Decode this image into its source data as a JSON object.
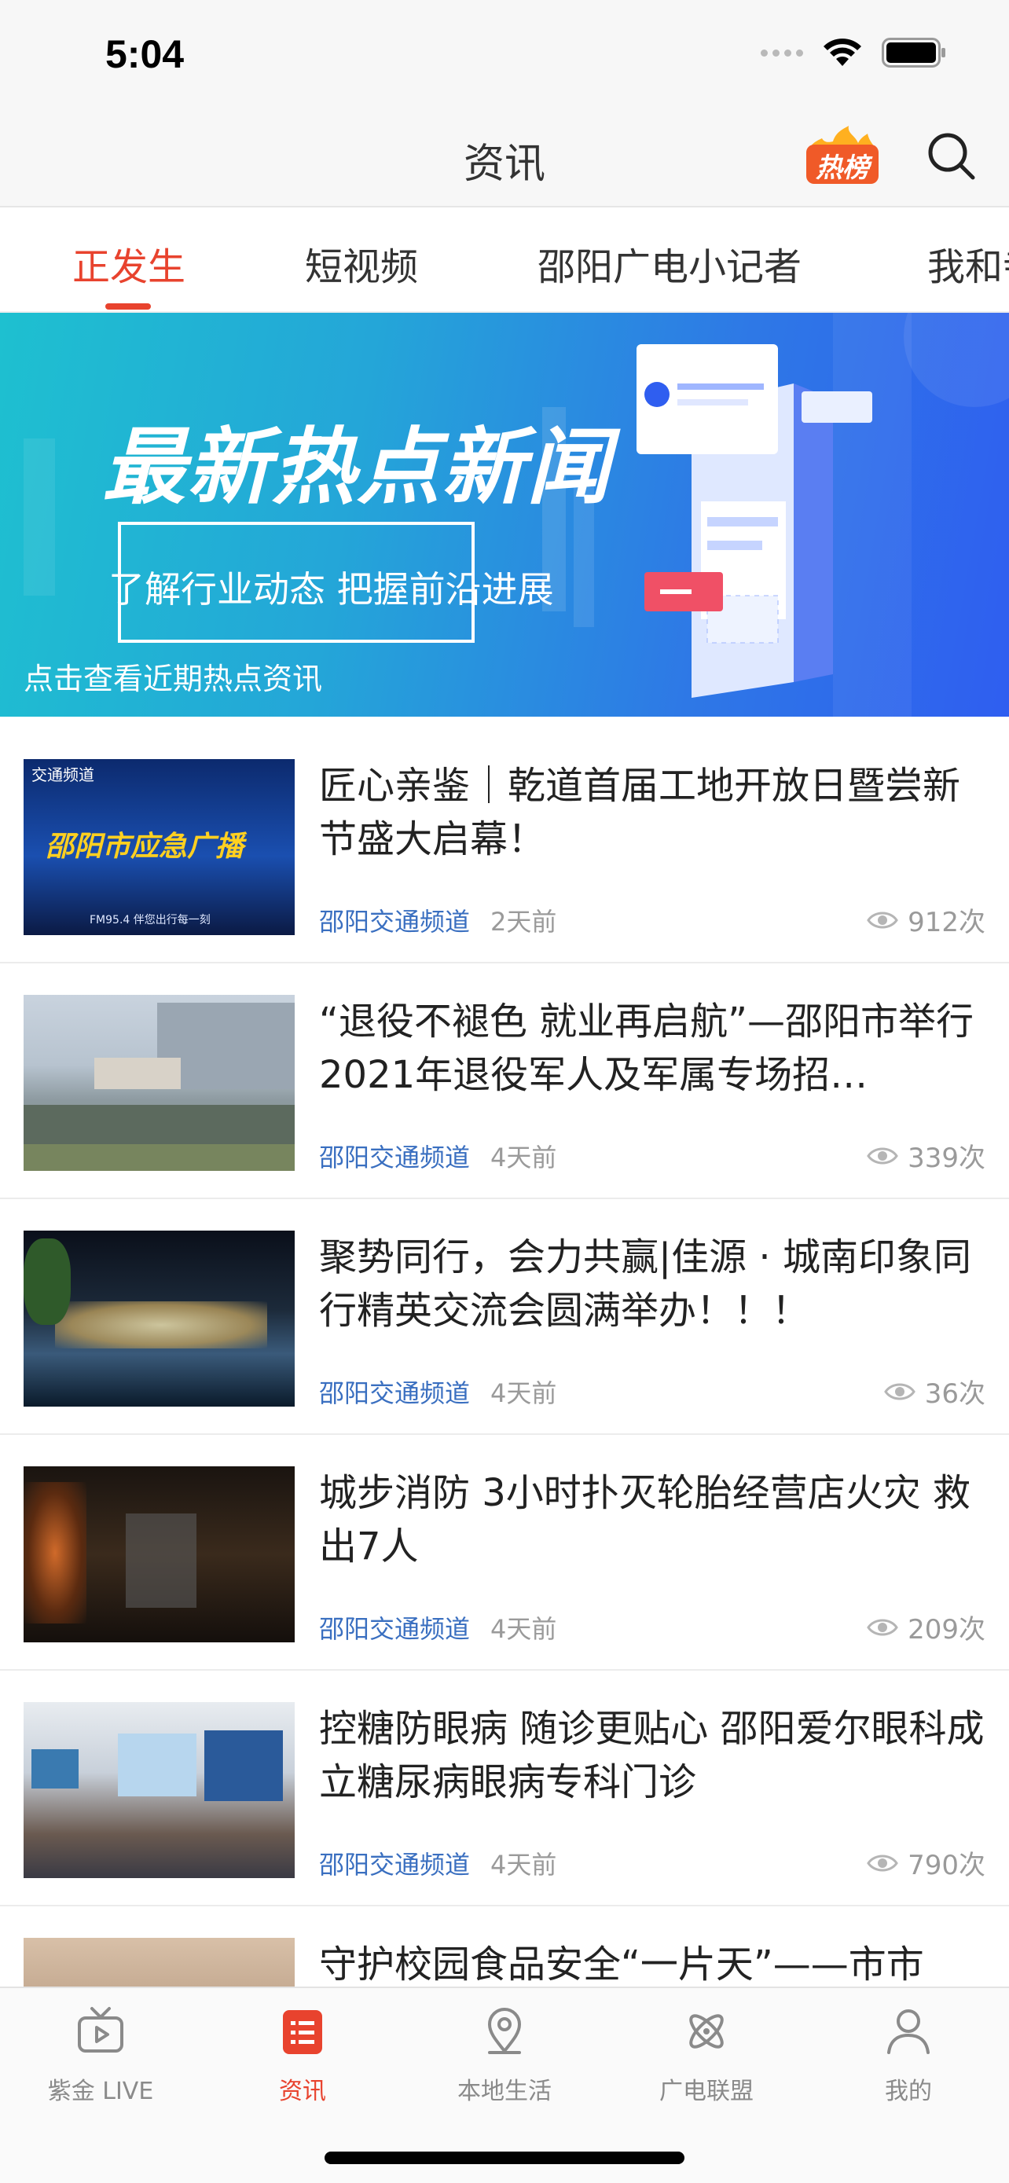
{
  "status_bar": {
    "time": "5:04"
  },
  "nav": {
    "title": "资讯",
    "hot_badge_text": "热榜"
  },
  "tabs": [
    {
      "label": "正发生",
      "active": true
    },
    {
      "label": "短视频",
      "active": false
    },
    {
      "label": "邵阳广电小记者",
      "active": false
    },
    {
      "label": "我和寺",
      "active": false
    }
  ],
  "banner": {
    "headline": "最新热点新闻",
    "subline": "了解行业动态 把握前沿进展",
    "caption": "点击查看近期热点资讯"
  },
  "news": [
    {
      "title": "匠心亲鉴｜乾道首届工地开放日暨尝新节盛大启幕！",
      "source": "邵阳交通频道",
      "time": "2天前",
      "views": "912次",
      "thumb": {
        "label": "邵阳市应急广播",
        "top_label": "交通频道",
        "freq": "FM95.4  伴您出行每一刻"
      }
    },
    {
      "title": "“退役不褪色 就业再启航”—邵阳市举行2021年退役军人及军属专场招…",
      "source": "邵阳交通频道",
      "time": "4天前",
      "views": "339次"
    },
    {
      "title": "聚势同行，会力共赢|佳源 · 城南印象同行精英交流会圆满举办！！！",
      "source": "邵阳交通频道",
      "time": "4天前",
      "views": "36次"
    },
    {
      "title": "城步消防 3小时扑灭轮胎经营店火灾 救出7人",
      "source": "邵阳交通频道",
      "time": "4天前",
      "views": "209次"
    },
    {
      "title": "控糖防眼病  随诊更贴心  邵阳爱尔眼科成立糖尿病眼病专科门诊",
      "source": "邵阳交通频道",
      "time": "4天前",
      "views": "790次"
    },
    {
      "title": "守护校园食品安全“一片天”——市市",
      "source": "",
      "time": "",
      "views": ""
    }
  ],
  "tab_bar": [
    {
      "label": "紫金 LIVE",
      "icon": "tv-icon",
      "active": false
    },
    {
      "label": "资讯",
      "icon": "news-list-icon",
      "active": true
    },
    {
      "label": "本地生活",
      "icon": "location-pin-icon",
      "active": false
    },
    {
      "label": "广电联盟",
      "icon": "atom-icon",
      "active": false
    },
    {
      "label": "我的",
      "icon": "person-icon",
      "active": false
    }
  ],
  "colors": {
    "accent": "#e8432e",
    "source_blue": "#3a6fc0",
    "muted": "#9a9a9a"
  }
}
